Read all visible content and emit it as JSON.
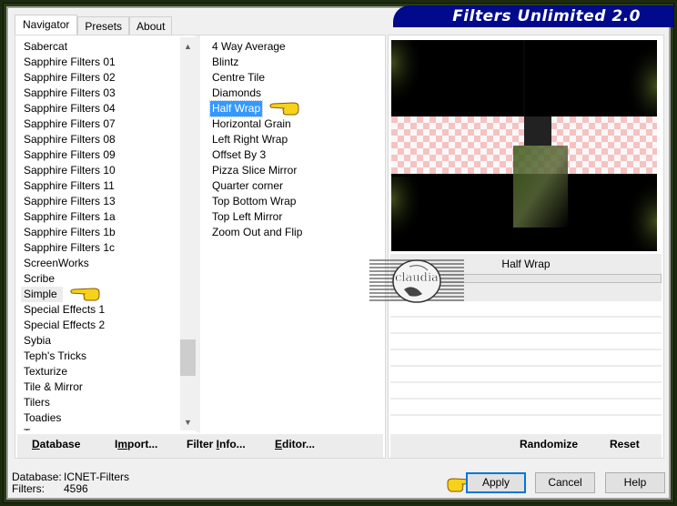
{
  "window": {
    "title": "Filters Unlimited 2.0"
  },
  "tabs": [
    {
      "label": "Navigator",
      "active": true
    },
    {
      "label": "Presets",
      "active": false
    },
    {
      "label": "About",
      "active": false
    }
  ],
  "categories": {
    "items": [
      "Sabercat",
      "Sapphire Filters 01",
      "Sapphire Filters 02",
      "Sapphire Filters 03",
      "Sapphire Filters 04",
      "Sapphire Filters 07",
      "Sapphire Filters 08",
      "Sapphire Filters 09",
      "Sapphire Filters 10",
      "Sapphire Filters 11",
      "Sapphire Filters 13",
      "Sapphire Filters 1a",
      "Sapphire Filters 1b",
      "Sapphire Filters 1c",
      "ScreenWorks",
      "Scribe",
      "Simple",
      "Special Effects 1",
      "Special Effects 2",
      "Sybia",
      "Teph's Tricks",
      "Texturize",
      "Tile & Mirror",
      "Tilers",
      "Toadies",
      "Tramages"
    ],
    "selected": "Simple",
    "scroll_position_fraction": 0.78
  },
  "filters": {
    "items": [
      "4 Way Average",
      "Blintz",
      "Centre Tile",
      "Diamonds",
      "Half Wrap",
      "Horizontal Grain",
      "Left Right Wrap",
      "Offset By 3",
      "Pizza Slice Mirror",
      "Quarter corner",
      "Top Bottom Wrap",
      "Top Left Mirror",
      "Zoom Out and Flip"
    ],
    "selected": "Half Wrap"
  },
  "panel_buttons": {
    "database": {
      "label": "Database",
      "accel": "D"
    },
    "import": {
      "label": "Import...",
      "accel": "m"
    },
    "filter_info": {
      "label": "Filter Info...",
      "accel": "I"
    },
    "editor": {
      "label": "Editor...",
      "accel": "E"
    }
  },
  "preview": {
    "filter_name": "Half Wrap",
    "progress_fraction": 0
  },
  "right_buttons": {
    "randomize": "Randomize",
    "reset": "Reset"
  },
  "status": {
    "database_label": "Database:",
    "database_value": "ICNET-Filters",
    "filters_label": "Filters:",
    "filters_value": "4596"
  },
  "dialog_buttons": {
    "apply": "Apply",
    "cancel": "Cancel",
    "help": "Help"
  },
  "watermark": {
    "text": "claudia"
  },
  "colors": {
    "selection": "#3399ff",
    "banner": "#000a8a",
    "focus_border": "#0078d7"
  }
}
